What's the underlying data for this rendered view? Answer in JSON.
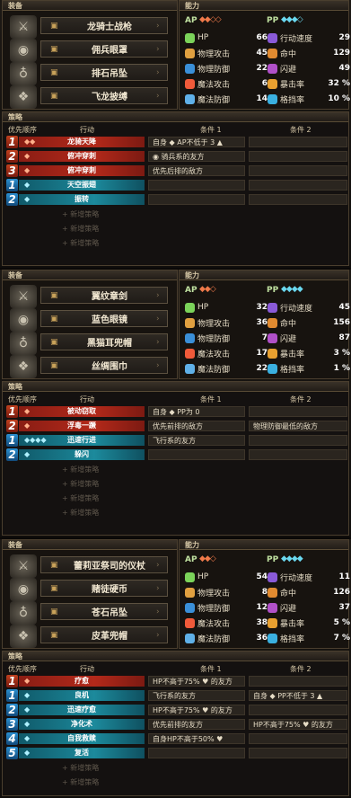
{
  "headers": {
    "equip": "装备",
    "ability": "能力",
    "strategy": "策略",
    "priority": "优先顺序",
    "action": "行动",
    "cond1": "条件 1",
    "cond2": "条件 2",
    "ap": "AP",
    "pp": "PP"
  },
  "new_strategy": "新增策略",
  "panels": [
    {
      "equip": [
        "龙骑士战枪",
        "佣兵眼罩",
        "排石吊坠",
        "飞龙披缚"
      ],
      "gear_icons": [
        "spear-icon",
        "eyepatch-icon",
        "amulet-icon",
        "bandana-icon"
      ],
      "ap_gems": "◆◆◇◇",
      "pp_gems": "◆◆◆◇",
      "stats": [
        [
          "HP",
          "66"
        ],
        [
          "物理攻击",
          "45"
        ],
        [
          "物理防御",
          "22"
        ],
        [
          "魔法攻击",
          "6"
        ],
        [
          "魔法防御",
          "14"
        ]
      ],
      "stats2": [
        [
          "行动速度",
          "29"
        ],
        [
          "命中",
          "129"
        ],
        [
          "闪避",
          "49"
        ],
        [
          "暴击率",
          "32 %"
        ],
        [
          "格挡率",
          "10 %"
        ]
      ],
      "rows": [
        {
          "n": "1",
          "t": "r",
          "gem": "◆◆",
          "label": "龙骑天降",
          "c1": "自身 ◆ AP不低于 3 ▲",
          "c2": ""
        },
        {
          "n": "2",
          "t": "r",
          "gem": "◆",
          "label": "俯冲穿刺",
          "c1": "◉ 骑兵系的友方",
          "c2": ""
        },
        {
          "n": "3",
          "t": "r",
          "gem": "◆",
          "label": "俯冲穿刺",
          "c1": "优先后排的敌方",
          "c2": ""
        },
        {
          "n": "1",
          "t": "b",
          "gem": "◆",
          "label": "天空振翅",
          "c1": "",
          "c2": ""
        },
        {
          "n": "2",
          "t": "b",
          "gem": "◆",
          "label": "振转",
          "c1": "",
          "c2": ""
        }
      ],
      "new_count": 3
    },
    {
      "equip": [
        "翼纹章剑",
        "蓝色眼镜",
        "黑猫耳兜帽",
        "丝绸围巾"
      ],
      "gear_icons": [
        "sword-icon",
        "goggles-icon",
        "cat-hood-icon",
        "scarf-icon"
      ],
      "ap_gems": "◆◆◇",
      "pp_gems": "◆◆◆◆",
      "stats": [
        [
          "HP",
          "32"
        ],
        [
          "物理攻击",
          "36"
        ],
        [
          "物理防御",
          "7"
        ],
        [
          "魔法攻击",
          "17"
        ],
        [
          "魔法防御",
          "22"
        ]
      ],
      "stats2": [
        [
          "行动速度",
          "45"
        ],
        [
          "命中",
          "156"
        ],
        [
          "闪避",
          "87"
        ],
        [
          "暴击率",
          "3 %"
        ],
        [
          "格挡率",
          "1 %"
        ]
      ],
      "rows": [
        {
          "n": "1",
          "t": "r",
          "gem": "◆",
          "label": "被动窃取",
          "c1": "自身 ◆ PP为 0",
          "c2": ""
        },
        {
          "n": "2",
          "t": "r",
          "gem": "◆",
          "label": "浮毒一蹶",
          "c1": "优先前排的敌方",
          "c2": "物理防御最低的敌方"
        },
        {
          "n": "1",
          "t": "b",
          "gem": "◆◆◆◆",
          "label": "迅速行进",
          "c1": "飞行系的友方",
          "c2": ""
        },
        {
          "n": "2",
          "t": "b",
          "gem": "◆",
          "label": "躲闪",
          "c1": "",
          "c2": ""
        }
      ],
      "new_count": 4
    },
    {
      "equip": [
        "蕾莉亚祭司的仪杖",
        "赌徒硬币",
        "苍石吊坠",
        "皮革兜帽"
      ],
      "gear_icons": [
        "staff-icon",
        "coin-icon",
        "pendant-icon",
        "leather-hood-icon"
      ],
      "ap_gems": "◆◆◇",
      "pp_gems": "◆◆◆◆",
      "stats": [
        [
          "HP",
          "54"
        ],
        [
          "物理攻击",
          "8"
        ],
        [
          "物理防御",
          "12"
        ],
        [
          "魔法攻击",
          "38"
        ],
        [
          "魔法防御",
          "36"
        ]
      ],
      "stats2": [
        [
          "行动速度",
          "11"
        ],
        [
          "命中",
          "126"
        ],
        [
          "闪避",
          "37"
        ],
        [
          "暴击率",
          "5 %"
        ],
        [
          "格挡率",
          "7 %"
        ]
      ],
      "rows": [
        {
          "n": "1",
          "t": "r",
          "gem": "◆",
          "label": "疗愈",
          "c1": "HP不高于75% ♥ 的友方",
          "c2": ""
        },
        {
          "n": "1",
          "t": "b",
          "gem": "◆",
          "label": "良机",
          "c1": "飞行系的友方",
          "c2": "自身 ◆ PP不低于 3 ▲"
        },
        {
          "n": "2",
          "t": "b",
          "gem": "◆",
          "label": "迅速疗愈",
          "c1": "HP不高于75% ♥ 的友方",
          "c2": ""
        },
        {
          "n": "3",
          "t": "b",
          "gem": "◆",
          "label": "净化术",
          "c1": "优先前排的友方",
          "c2": "HP不高于75% ♥ 的友方"
        },
        {
          "n": "4",
          "t": "b",
          "gem": "◆",
          "label": "自我救赎",
          "c1": "自身HP不高于50% ♥",
          "c2": ""
        },
        {
          "n": "5",
          "t": "b",
          "gem": "◆",
          "label": "复活",
          "c1": "",
          "c2": ""
        }
      ],
      "new_count": 2
    }
  ]
}
